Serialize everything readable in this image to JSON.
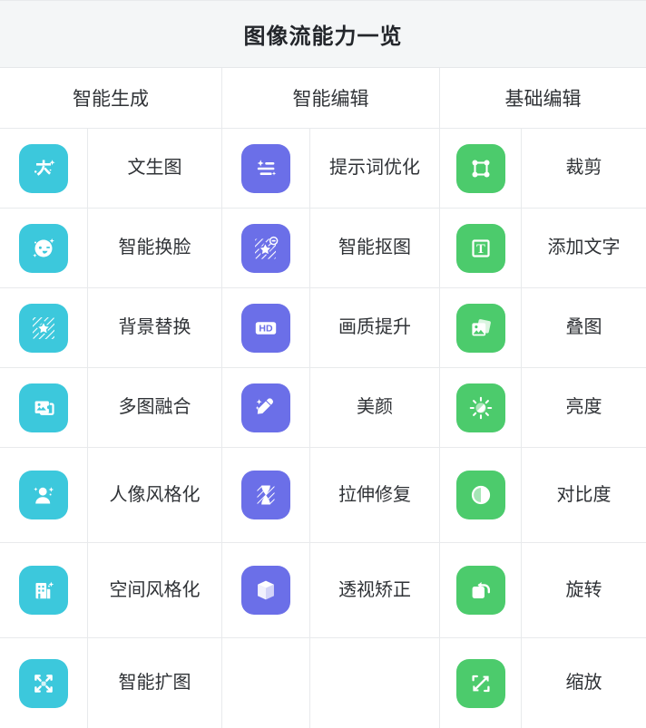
{
  "title": "图像流能力一览",
  "colors": {
    "header_bg": "#f4f6f7",
    "border": "#e8eaec",
    "cyan": "#3cc8dc",
    "purple": "#6b6fe8",
    "green": "#4ccb6c",
    "text": "#2f3236"
  },
  "groups": [
    {
      "label": "智能生成"
    },
    {
      "label": "智能编辑"
    },
    {
      "label": "基础编辑"
    }
  ],
  "columns": [
    {
      "group": "智能生成",
      "accent": "#3cc8dc",
      "items": [
        {
          "label": "文生图",
          "icon": "text-to-image-icon"
        },
        {
          "label": "智能换脸",
          "icon": "face-swap-icon"
        },
        {
          "label": "背景替换",
          "icon": "background-replace-icon"
        },
        {
          "label": "多图融合",
          "icon": "image-fusion-icon"
        },
        {
          "label": "人像风格化",
          "icon": "portrait-style-icon"
        },
        {
          "label": "空间风格化",
          "icon": "space-style-icon"
        },
        {
          "label": "智能扩图",
          "icon": "outpaint-icon"
        }
      ]
    },
    {
      "group": "智能编辑",
      "accent": "#6b6fe8",
      "items": [
        {
          "label": "提示词优化",
          "icon": "prompt-optimize-icon"
        },
        {
          "label": "智能抠图",
          "icon": "cutout-icon"
        },
        {
          "label": "画质提升",
          "icon": "hd-enhance-icon"
        },
        {
          "label": "美颜",
          "icon": "beautify-icon"
        },
        {
          "label": "拉伸修复",
          "icon": "stretch-repair-icon"
        },
        {
          "label": "透视矫正",
          "icon": "perspective-correct-icon"
        },
        {
          "label": "",
          "icon": ""
        }
      ]
    },
    {
      "group": "基础编辑",
      "accent": "#4ccb6c",
      "items": [
        {
          "label": "裁剪",
          "icon": "crop-icon"
        },
        {
          "label": "添加文字",
          "icon": "add-text-icon"
        },
        {
          "label": "叠图",
          "icon": "overlay-icon"
        },
        {
          "label": "亮度",
          "icon": "brightness-icon"
        },
        {
          "label": "对比度",
          "icon": "contrast-icon"
        },
        {
          "label": "旋转",
          "icon": "rotate-icon"
        },
        {
          "label": "缩放",
          "icon": "scale-icon"
        }
      ]
    }
  ]
}
